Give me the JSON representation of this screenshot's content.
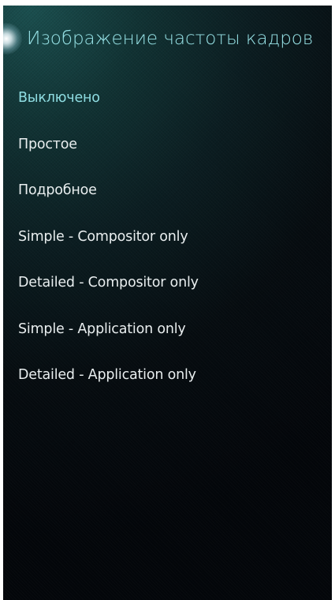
{
  "page": {
    "title": "Изображение частоты кадров"
  },
  "options": [
    {
      "label": "Выключено",
      "selected": true
    },
    {
      "label": "Простое",
      "selected": false
    },
    {
      "label": "Подробное",
      "selected": false
    },
    {
      "label": "Simple - Compositor only",
      "selected": false
    },
    {
      "label": "Detailed - Compositor only",
      "selected": false
    },
    {
      "label": "Simple - Application only",
      "selected": false
    },
    {
      "label": "Detailed - Application only",
      "selected": false
    }
  ],
  "colors": {
    "accent": "#97e2e6",
    "text": "#e9eeef",
    "background": "#03060a"
  }
}
